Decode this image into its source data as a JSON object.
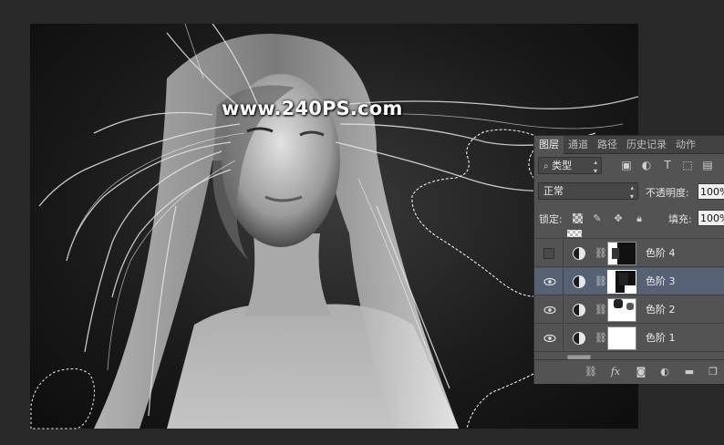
{
  "watermark": "www.240PS.com",
  "panel": {
    "tabs": [
      {
        "label": "图层",
        "active": true
      },
      {
        "label": "通道",
        "active": false
      },
      {
        "label": "路径",
        "active": false
      },
      {
        "label": "历史记录",
        "active": false
      },
      {
        "label": "动作",
        "active": false
      }
    ],
    "filter_type": "类型",
    "blend_mode": "正常",
    "opacity_label": "不透明度:",
    "opacity_value": "100%",
    "lock_label": "锁定:",
    "fill_label": "填充:",
    "fill_value": "100%",
    "layers": [
      {
        "name": "色阶 4",
        "visible": false,
        "selected": false,
        "icon": "adjustment-levels-icon"
      },
      {
        "name": "色阶 3",
        "visible": true,
        "selected": true,
        "icon": "adjustment-levels-icon"
      },
      {
        "name": "色阶 2",
        "visible": true,
        "selected": false,
        "icon": "adjustment-levels-icon"
      },
      {
        "name": "色阶 1",
        "visible": true,
        "selected": false,
        "icon": "adjustment-levels-icon"
      }
    ],
    "footer_icons": [
      "link-icon",
      "fx-icon",
      "add-mask-icon",
      "adjustment-icon",
      "folder-icon",
      "new-layer-icon"
    ]
  }
}
